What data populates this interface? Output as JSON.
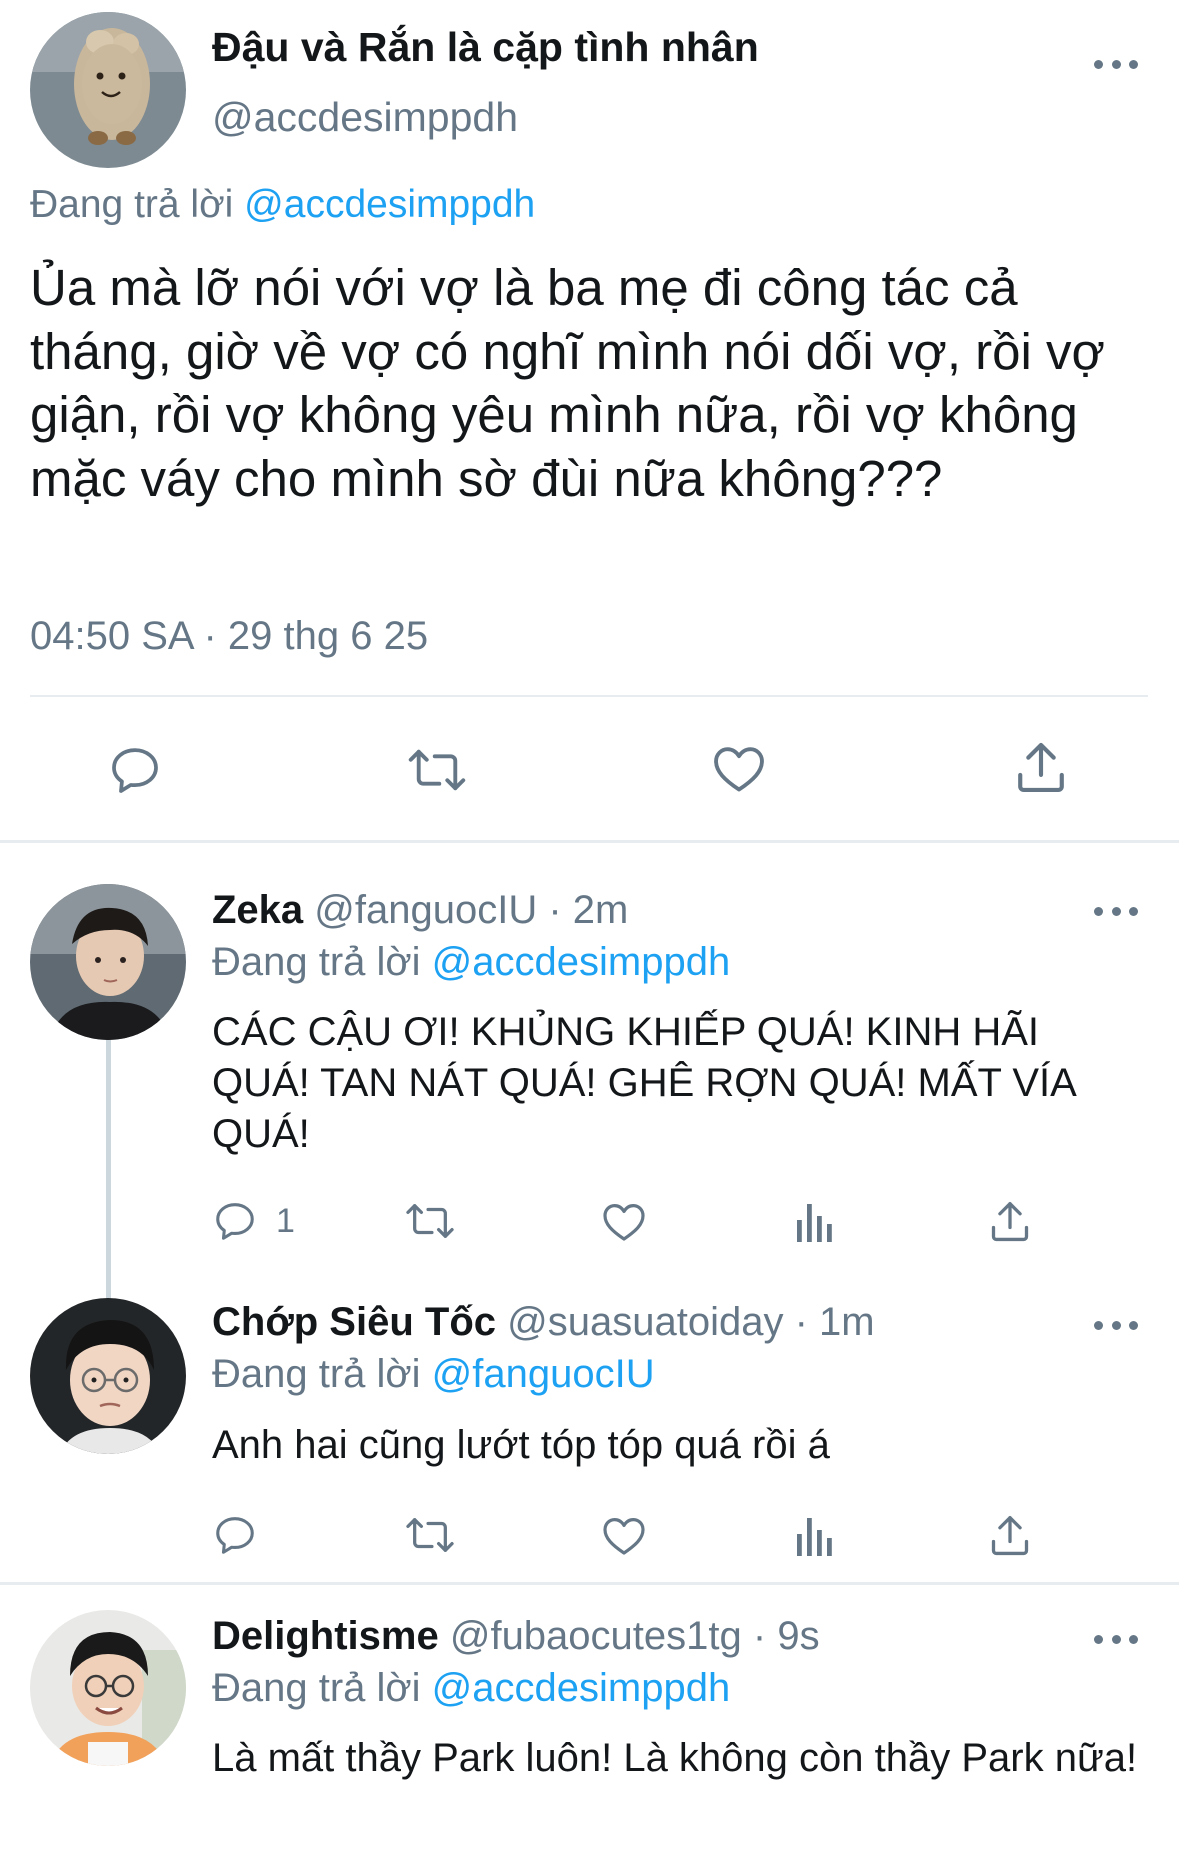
{
  "main_tweet": {
    "display_name": "Đậu và Rắn là cặp tình nhân",
    "handle": "@accdesimppdh",
    "replying_prefix": "Đang trả lời",
    "replying_to": "@accdesimppdh",
    "text": "Ủa mà lỡ nói với vợ là ba mẹ đi công tác cả tháng, giờ về vợ có nghĩ mình nói dối vợ, rồi vợ giận, rồi vợ không yêu mình nữa, rồi vợ không mặc váy cho mình sờ đùi nữa không???",
    "timestamp": "04:50 SA · 29 thg 6 25",
    "actions": [
      "reply-icon",
      "retweet-icon",
      "like-icon",
      "share-icon"
    ]
  },
  "replies": [
    {
      "display_name": "Zeka",
      "handle": "@fanguocIU",
      "time": "· 2m",
      "replying_prefix": "Đang trả lời",
      "replying_to": "@accdesimppdh",
      "text": "CÁC CẬU ƠI! KHỦNG KHIẾP QUÁ! KINH HÃI QUÁ! TAN NÁT QUÁ! GHÊ RỢN QUÁ! MẤT VÍA QUÁ!",
      "reply_count": "1"
    },
    {
      "display_name": "Chớp Siêu Tốc",
      "handle": "@suasuatoiday",
      "time": "· 1m",
      "replying_prefix": "Đang trả lời",
      "replying_to": "@fanguocIU",
      "text": "Anh hai cũng lướt tóp tóp quá rồi á",
      "reply_count": ""
    },
    {
      "display_name": "Delightisme",
      "handle": "@fubaocutes1tg",
      "time": "· 9s",
      "replying_prefix": "Đang trả lời",
      "replying_to": "@accdesimppdh",
      "text": "Là mất thầy Park luôn! Là không còn thầy Park nữa!",
      "reply_count": ""
    }
  ],
  "colors": {
    "text": "#14171a",
    "secondary": "#657786",
    "link": "#1da1f2",
    "divider": "#e6ecf0"
  }
}
